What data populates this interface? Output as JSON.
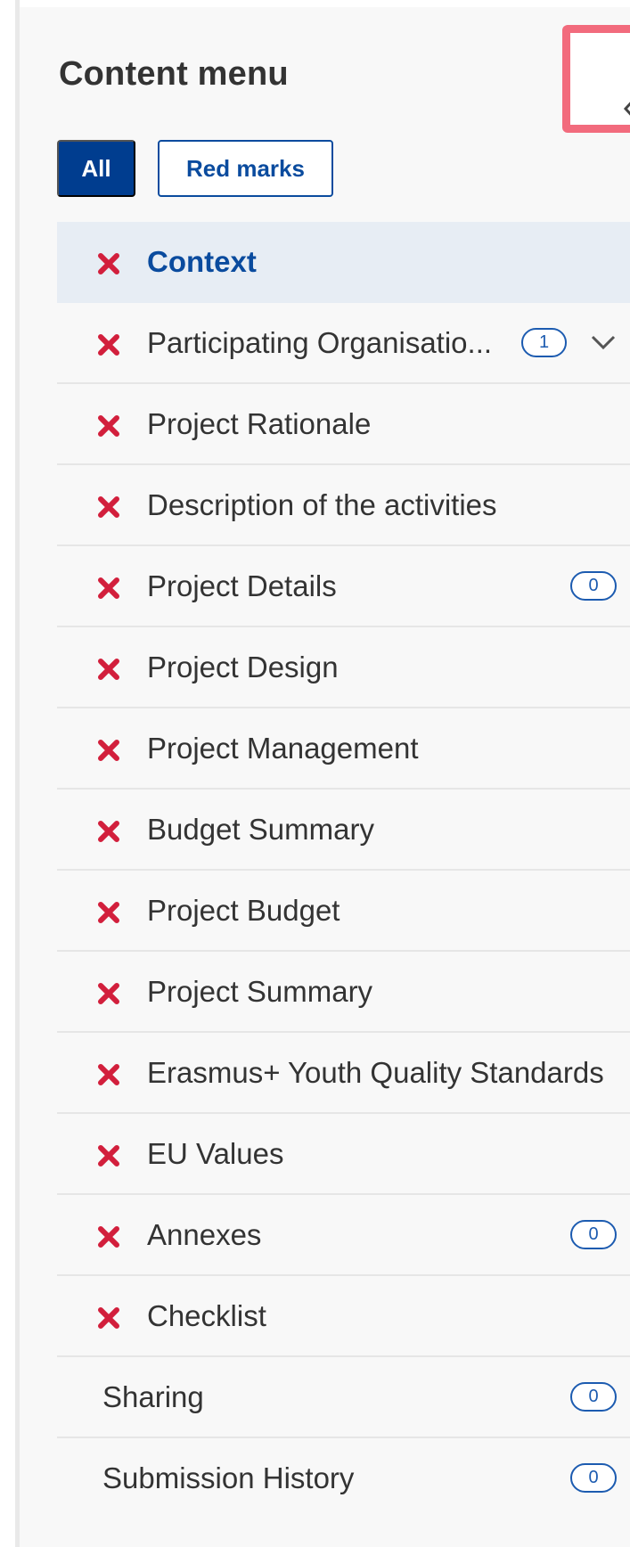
{
  "panel": {
    "title": "Content menu"
  },
  "filters": {
    "all_label": "All",
    "red_marks_label": "Red marks"
  },
  "colors": {
    "accent": "#003d8f",
    "error_mark": "#d21f3c",
    "highlight_border": "#f26b7d",
    "active_bg": "#e7edf4"
  },
  "menu": {
    "items": [
      {
        "label": "Context",
        "status_icon": "red-x-icon",
        "active": true
      },
      {
        "label": "Participating Organisatio...",
        "status_icon": "red-x-icon",
        "badge": "1",
        "expandable": true
      },
      {
        "label": "Project Rationale",
        "status_icon": "red-x-icon"
      },
      {
        "label": "Description of the activities",
        "status_icon": "red-x-icon"
      },
      {
        "label": "Project Details",
        "status_icon": "red-x-icon",
        "badge": "0"
      },
      {
        "label": "Project Design",
        "status_icon": "red-x-icon"
      },
      {
        "label": "Project Management",
        "status_icon": "red-x-icon"
      },
      {
        "label": "Budget Summary",
        "status_icon": "red-x-icon"
      },
      {
        "label": "Project Budget",
        "status_icon": "red-x-icon"
      },
      {
        "label": "Project Summary",
        "status_icon": "red-x-icon"
      },
      {
        "label": "Erasmus+ Youth Quality Standards",
        "status_icon": "red-x-icon"
      },
      {
        "label": "EU Values",
        "status_icon": "red-x-icon"
      },
      {
        "label": "Annexes",
        "status_icon": "red-x-icon",
        "badge": "0"
      },
      {
        "label": "Checklist",
        "status_icon": "red-x-icon"
      },
      {
        "label": "Sharing",
        "badge": "0"
      },
      {
        "label": "Submission History",
        "badge": "0"
      }
    ]
  }
}
